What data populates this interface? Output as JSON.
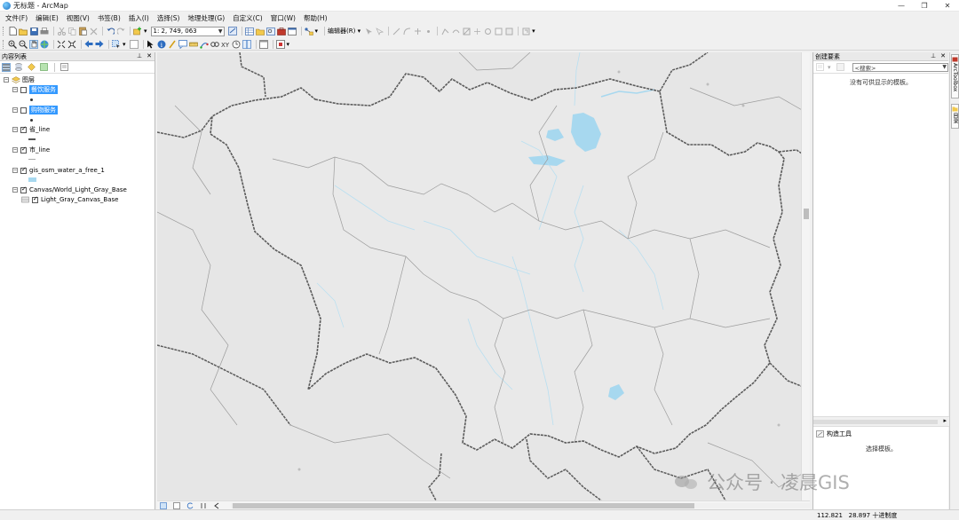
{
  "window": {
    "title": "无标题 - ArcMap",
    "min_glyph": "—",
    "max_glyph": "❐",
    "close_glyph": "✕"
  },
  "menu": [
    "文件(F)",
    "编辑(E)",
    "视图(V)",
    "书签(B)",
    "插入(I)",
    "选择(S)",
    "地理处理(G)",
    "自定义(C)",
    "窗口(W)",
    "帮助(H)"
  ],
  "toolbar": {
    "scale": "1: 2, 749, 063",
    "editor_label": "编辑器(R) ▾"
  },
  "toc": {
    "title": "内容列表",
    "data_frame": "图层",
    "layers": [
      {
        "label": "餐饮服务",
        "checked": false,
        "selected": true,
        "symbol": "point"
      },
      {
        "label": "购物服务",
        "checked": false,
        "selected": true,
        "symbol": "point"
      },
      {
        "label": "省_line",
        "checked": true,
        "selected": false,
        "symbol": "line-dark"
      },
      {
        "label": "市_line",
        "checked": true,
        "selected": false,
        "symbol": "line-gray"
      },
      {
        "label": "gis_osm_water_a_free_1",
        "checked": true,
        "selected": false,
        "symbol": "polygon"
      },
      {
        "label": "Canvas/World_Light_Gray_Base",
        "checked": true,
        "selected": false,
        "symbol": "group"
      },
      {
        "label": "Light_Gray_Canvas_Base",
        "checked": true,
        "selected": false,
        "symbol": "basemap"
      }
    ]
  },
  "create_features": {
    "title": "创建要素",
    "search_placeholder": "<搜索>",
    "no_templates_msg": "没有可供显示的模板。",
    "construct_tools_title": "构造工具",
    "select_template_msg": "选择模板。"
  },
  "side_tabs": [
    "ArcToolbox",
    "目录"
  ],
  "status": {
    "coord_x": "112.821",
    "coord_y": "28.897",
    "units": "十进制度"
  },
  "watermark": {
    "text": "公众号 · 凌晨GIS"
  },
  "colors": {
    "selection": "#3399ff",
    "water": "#a7d8ef",
    "map_bg": "#e6e6e6",
    "province_line": "#5a5a5a",
    "city_line": "#9c9c9c"
  }
}
